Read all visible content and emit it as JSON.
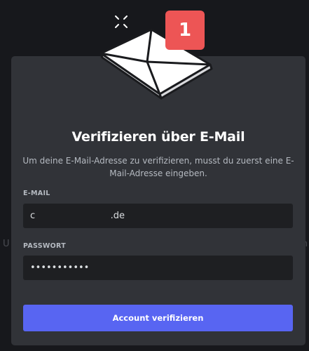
{
  "modal": {
    "title": "Verifizieren über E-Mail",
    "subtitle": "Um deine E-Mail-Adresse zu verifizieren, musst du zuerst eine E-Mail-Adresse eingeben.",
    "email": {
      "label": "E-MAIL",
      "value": "c                          .de"
    },
    "password": {
      "label": "PASSWORT",
      "value": "•••••••••••"
    },
    "submit_label": "Account verifizieren"
  },
  "notification": {
    "count": "1",
    "color": "#ed5555"
  },
  "background": {
    "left_peek": "U",
    "right_peek": "n"
  },
  "colors": {
    "accent": "#5865f2",
    "modal_bg": "#313338",
    "input_bg": "#1e1f22",
    "page_bg": "#17181c"
  },
  "icons": {
    "illustration": "envelope-icon",
    "decoration": "sparkle-icon"
  }
}
